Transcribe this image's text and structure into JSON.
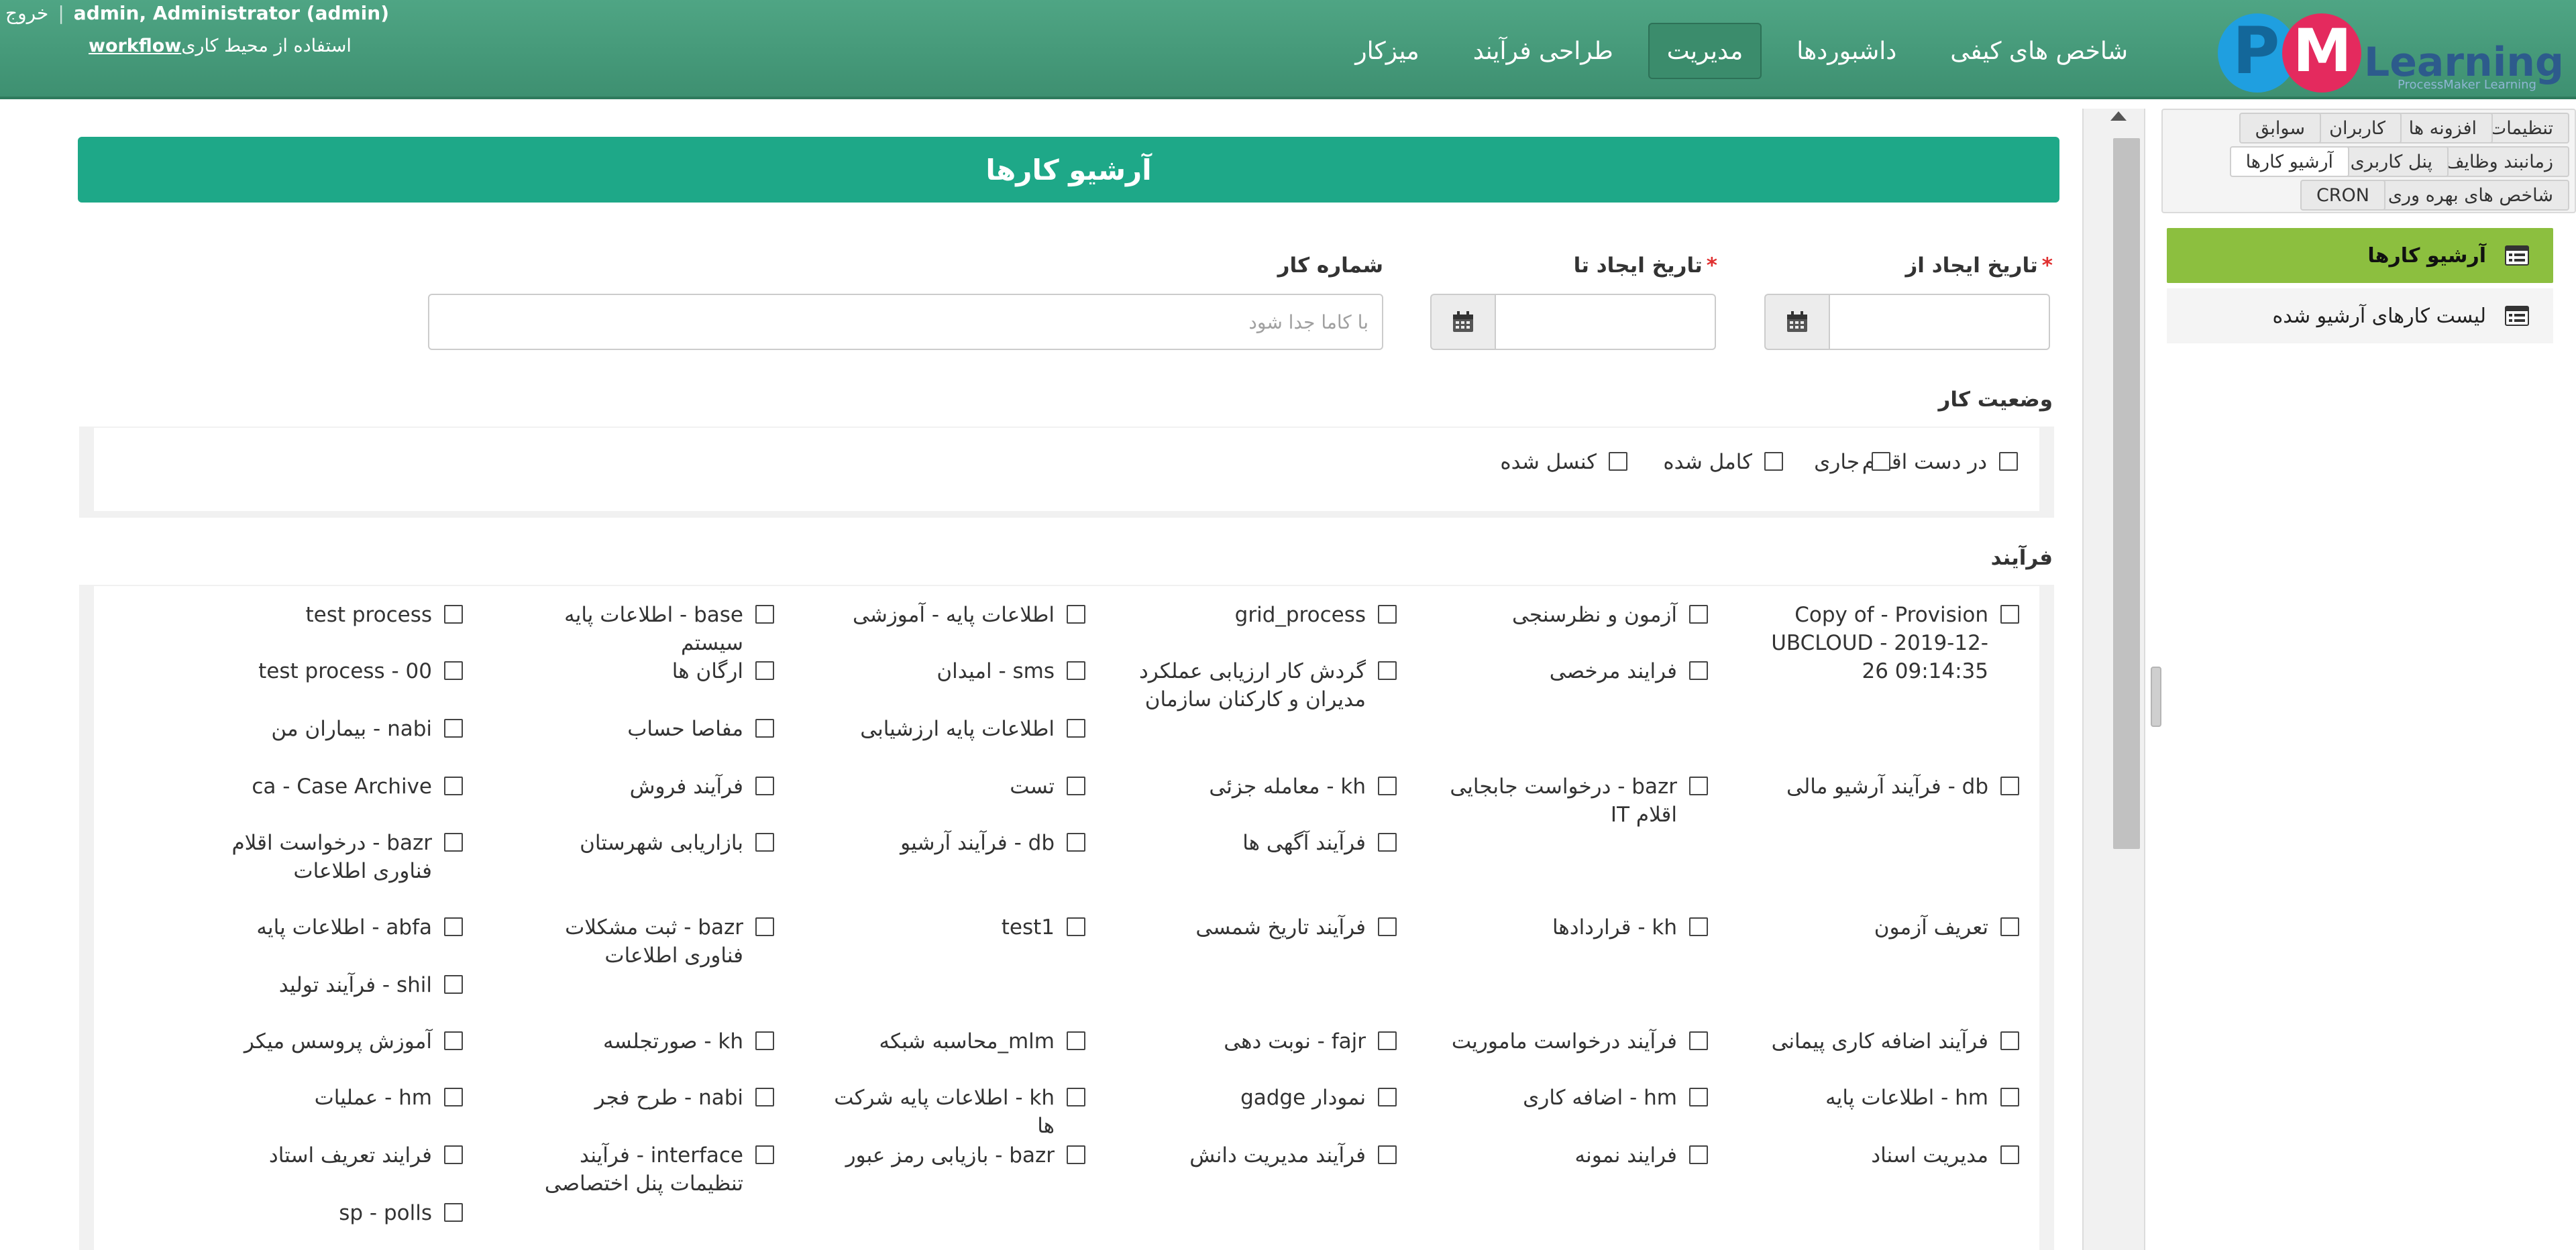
{
  "header": {
    "logout_label": "خروج",
    "user_label": "admin, Administrator (admin)",
    "workspace_prefix": "استفاده از محیط کاری",
    "workspace_name": "workflow",
    "nav": [
      {
        "label": "میزکار"
      },
      {
        "label": "طراحی فرآیند"
      },
      {
        "label": "مدیریت",
        "active": true
      },
      {
        "label": "داشبوردها"
      },
      {
        "label": "شاخص های کیفی"
      }
    ],
    "logo": {
      "text": "Learning",
      "tagline": "ProcessMaker Learning"
    }
  },
  "sidebar": {
    "tabs": [
      "تنظیمات",
      "افزونه ها",
      "کاربران",
      "سوابق",
      "زمانبند وظایف",
      "پنل کاربری",
      "آرشیو کارها",
      "شاخص های بهره وری",
      "CRON"
    ],
    "items": [
      {
        "label": "آرشیو کارها",
        "active": true
      },
      {
        "label": "لیست کارهای آرشیو شده",
        "active": false
      }
    ]
  },
  "main": {
    "title": "آرشیو کارها",
    "date_from_label": "تاریخ ایجاد از",
    "date_to_label": "تاریخ ایجاد تا",
    "required_mark": "*",
    "case_number_label": "شماره کار",
    "case_number_placeholder": "با کاما جدا شود",
    "status_title": "وضعیت کار",
    "statuses": [
      "در دست اقدام",
      "جاری",
      "کامل شده",
      "کنسل شده"
    ],
    "process_title": "فرآیند",
    "processes": [
      [
        "Copy of - Provision UBCLOUD - 2019-12-26 09:14:35",
        "آزمون و نظرسنجی",
        "grid_process",
        "اطلاعات پایه - آموزشی",
        "base - اطلاعات پایه سیستم",
        "test process"
      ],
      [
        "",
        "فرایند مرخصی",
        "گردش کار ارزیابی عملکرد مدیران و کارکنان سازمان",
        "sms - امیدان",
        "ارگان ها",
        "test process - 00"
      ],
      [
        "",
        "",
        "",
        "اطلاعات پایه ارزشیابی",
        "مفاصا حساب",
        "nabi - بیماران من"
      ],
      [
        "db - فرآیند آرشیو مالی",
        "bazr - درخواست جابجایی اقلام IT",
        "kh - معامله جزئی",
        "تست",
        "فرآیند فروش",
        "ca - Case Archive"
      ],
      [
        "",
        "",
        "فرآیند آگهی ها",
        "db - فرآیند آرشیو",
        "بازاریابی شهرستان",
        "bazr - درخواست اقلام فناوری اطلاعات"
      ],
      [
        "تعریف آزمون",
        "kh - قراردادها",
        "فرآیند تاریخ شمسی",
        "test1",
        "bazr - ثبت مشکلات فناوری اطلاعات",
        "abfa - اطلاعات پایه"
      ],
      [
        "",
        "",
        "",
        "",
        "",
        "shil - فرآیند تولید"
      ],
      [
        "فرآیند اضافه کاری پیمانی",
        "فرآیند درخواست ماموریت",
        "fajr - نوبت دهی",
        "mlm_محاسبه شبکه",
        "kh - صورتجلسه",
        "آموزش پروسس میکر"
      ],
      [
        "hm - اطلاعات پایه",
        "hm - اضافه کاری",
        "نمودار gadge",
        "kh - اطلاعات پایه شرکت ها",
        "nabi - طرح فجر",
        "hm - عملیات"
      ],
      [
        "مدیریت اسناد",
        "فرایند نمونه",
        "فرآیند مدیریت دانش",
        "bazr - بازیابی رمز عبور",
        "interface - فرآیند تنظیمات پنل اختصاصی",
        "فرایند تعریف استاد"
      ],
      [
        "",
        "",
        "",
        "",
        "",
        "sp - polls"
      ]
    ]
  }
}
